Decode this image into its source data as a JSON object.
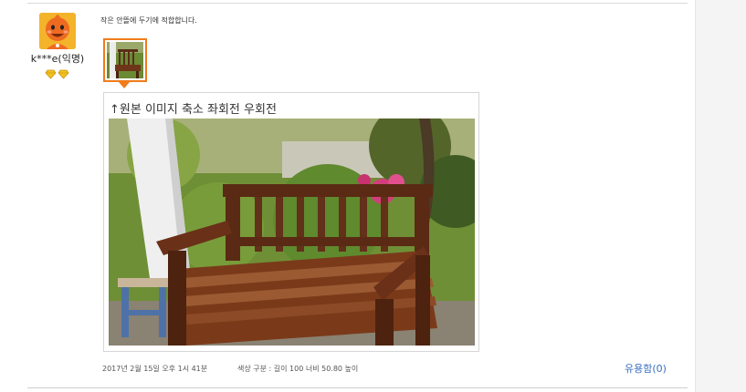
{
  "review": {
    "reviewer_name": "k***e(익명)",
    "text": "작은 안뜰에 두기에 적합합니다.",
    "image_caption": "↑원본 이미지 축소 좌회전 우회전",
    "date": "2017년 2월 15일 오후 1시 41분",
    "option": "색상 구분 : 길이 100 너비 50.80 높이",
    "helpful_label": "유용함(0)"
  },
  "icons": {
    "avatar": "orange-cartoon-avatar",
    "grade": "diamond-grade-icons",
    "photo": "wooden-garden-bench-photo"
  },
  "colors": {
    "thumb_border": "#f07c1c",
    "helpful_link": "#3a6fbf",
    "avatar_bg": "#f3b32b"
  }
}
